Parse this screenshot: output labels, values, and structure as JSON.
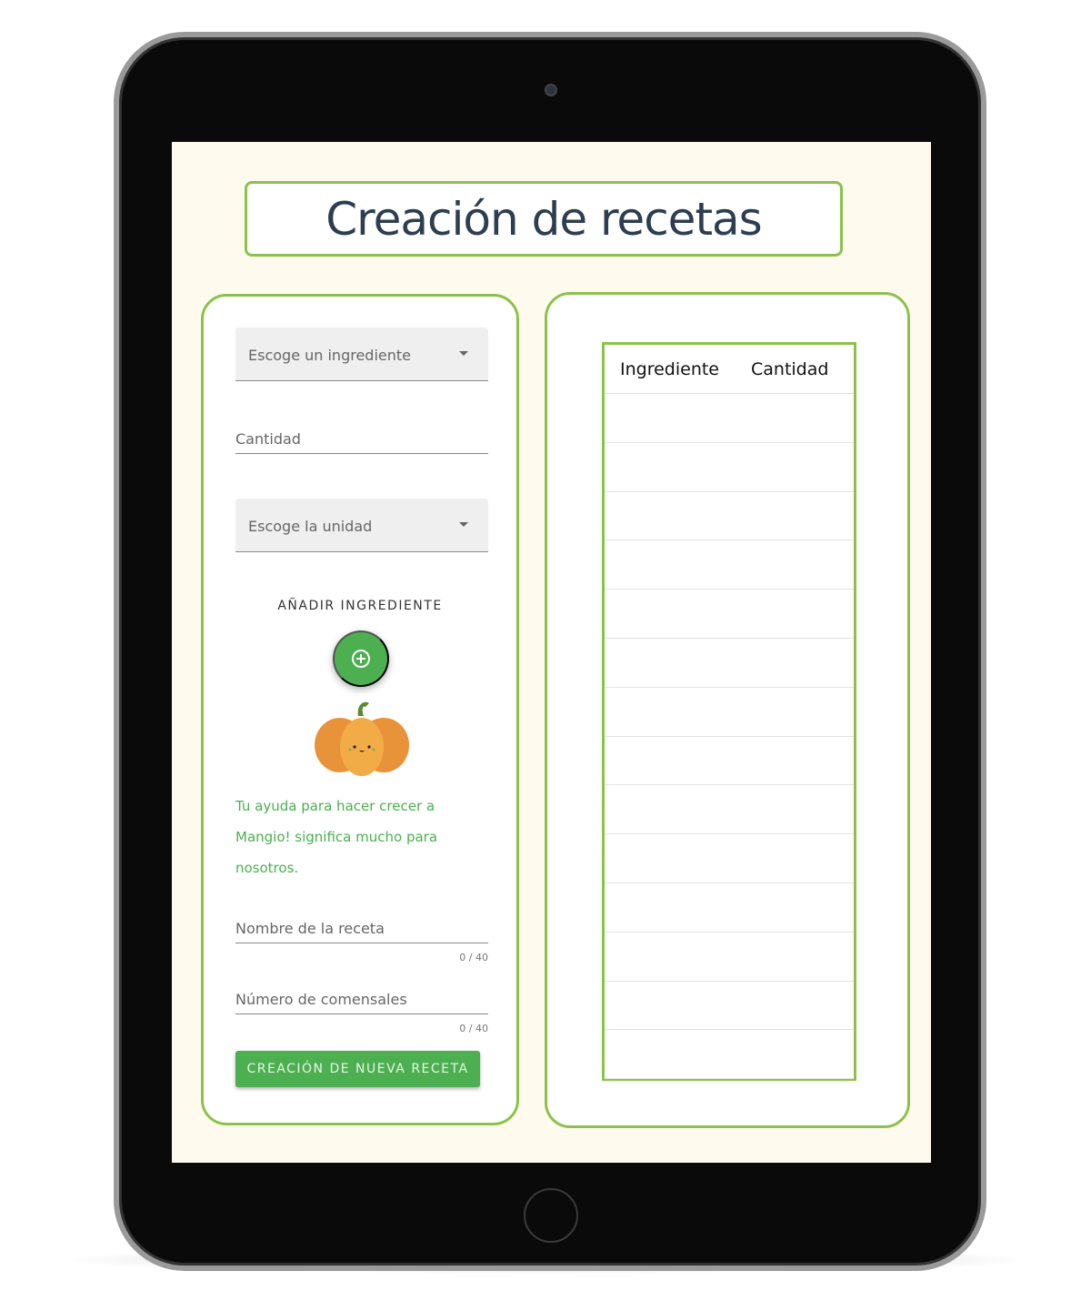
{
  "page": {
    "title": "Creación de recetas"
  },
  "form": {
    "ingredient_select": {
      "placeholder": "Escoge un ingrediente"
    },
    "quantity_field": {
      "label": "Cantidad"
    },
    "unit_select": {
      "placeholder": "Escoge la unidad"
    },
    "add_ingredient_label": "AÑADIR INGREDIENTE",
    "message": "Tu ayuda para hacer crecer a Mangio! significa mucho para nosotros.",
    "recipe_name": {
      "label": "Nombre de la receta",
      "counter": "0 / 40"
    },
    "diners": {
      "label": "Número de comensales",
      "counter": "0 / 40"
    },
    "submit_label": "CREACIÓN DE NUEVA RECETA"
  },
  "table": {
    "columns": [
      "Ingrediente",
      "Cantidad"
    ],
    "rows": []
  },
  "colors": {
    "accent": "#8bc34a",
    "primary": "#4caf50",
    "background": "#fffaee"
  }
}
